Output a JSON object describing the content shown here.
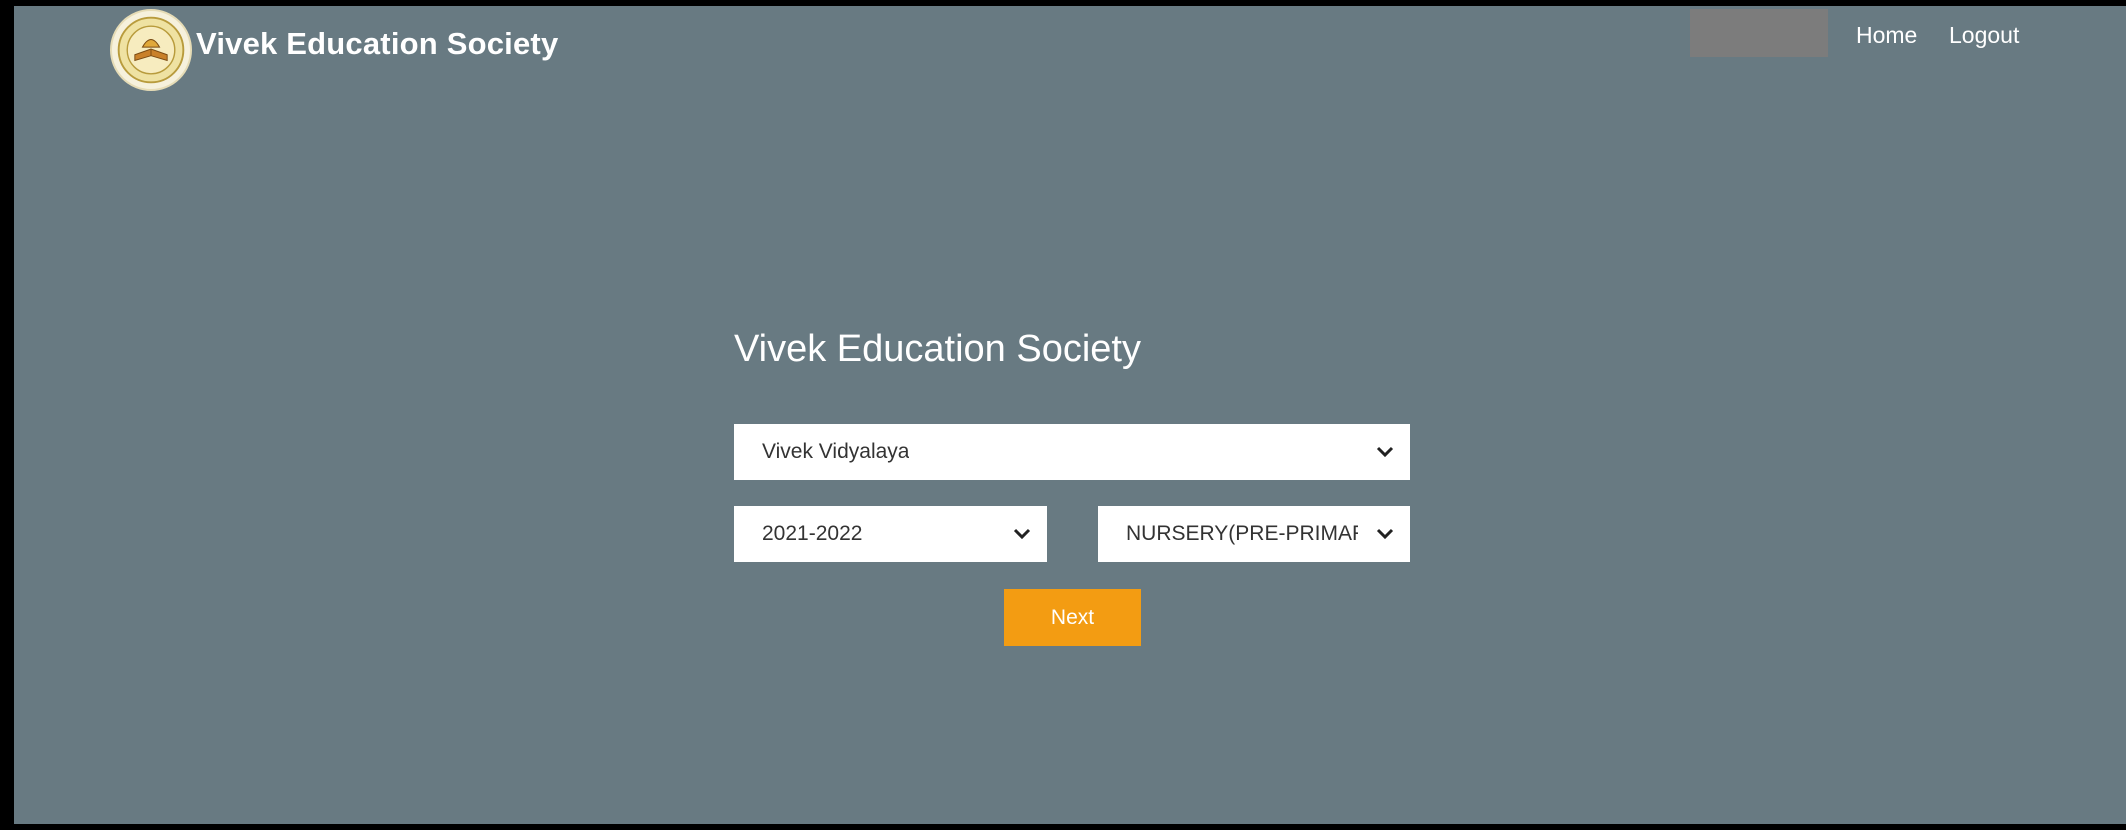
{
  "header": {
    "brand": "Vivek Education Society",
    "nav": {
      "home": "Home",
      "logout": "Logout"
    },
    "logo_icon": "school-emblem"
  },
  "main": {
    "title": "Vivek Education Society",
    "school_select": {
      "value": "Vivek Vidyalaya"
    },
    "year_select": {
      "value": "2021-2022"
    },
    "class_select": {
      "value": "NURSERY(PRE-PRIMARY"
    },
    "next_label": "Next"
  },
  "colors": {
    "background": "#687a82",
    "accent": "#f39c12",
    "text": "#ffffff",
    "redacted_user": "#7c7c7c"
  }
}
